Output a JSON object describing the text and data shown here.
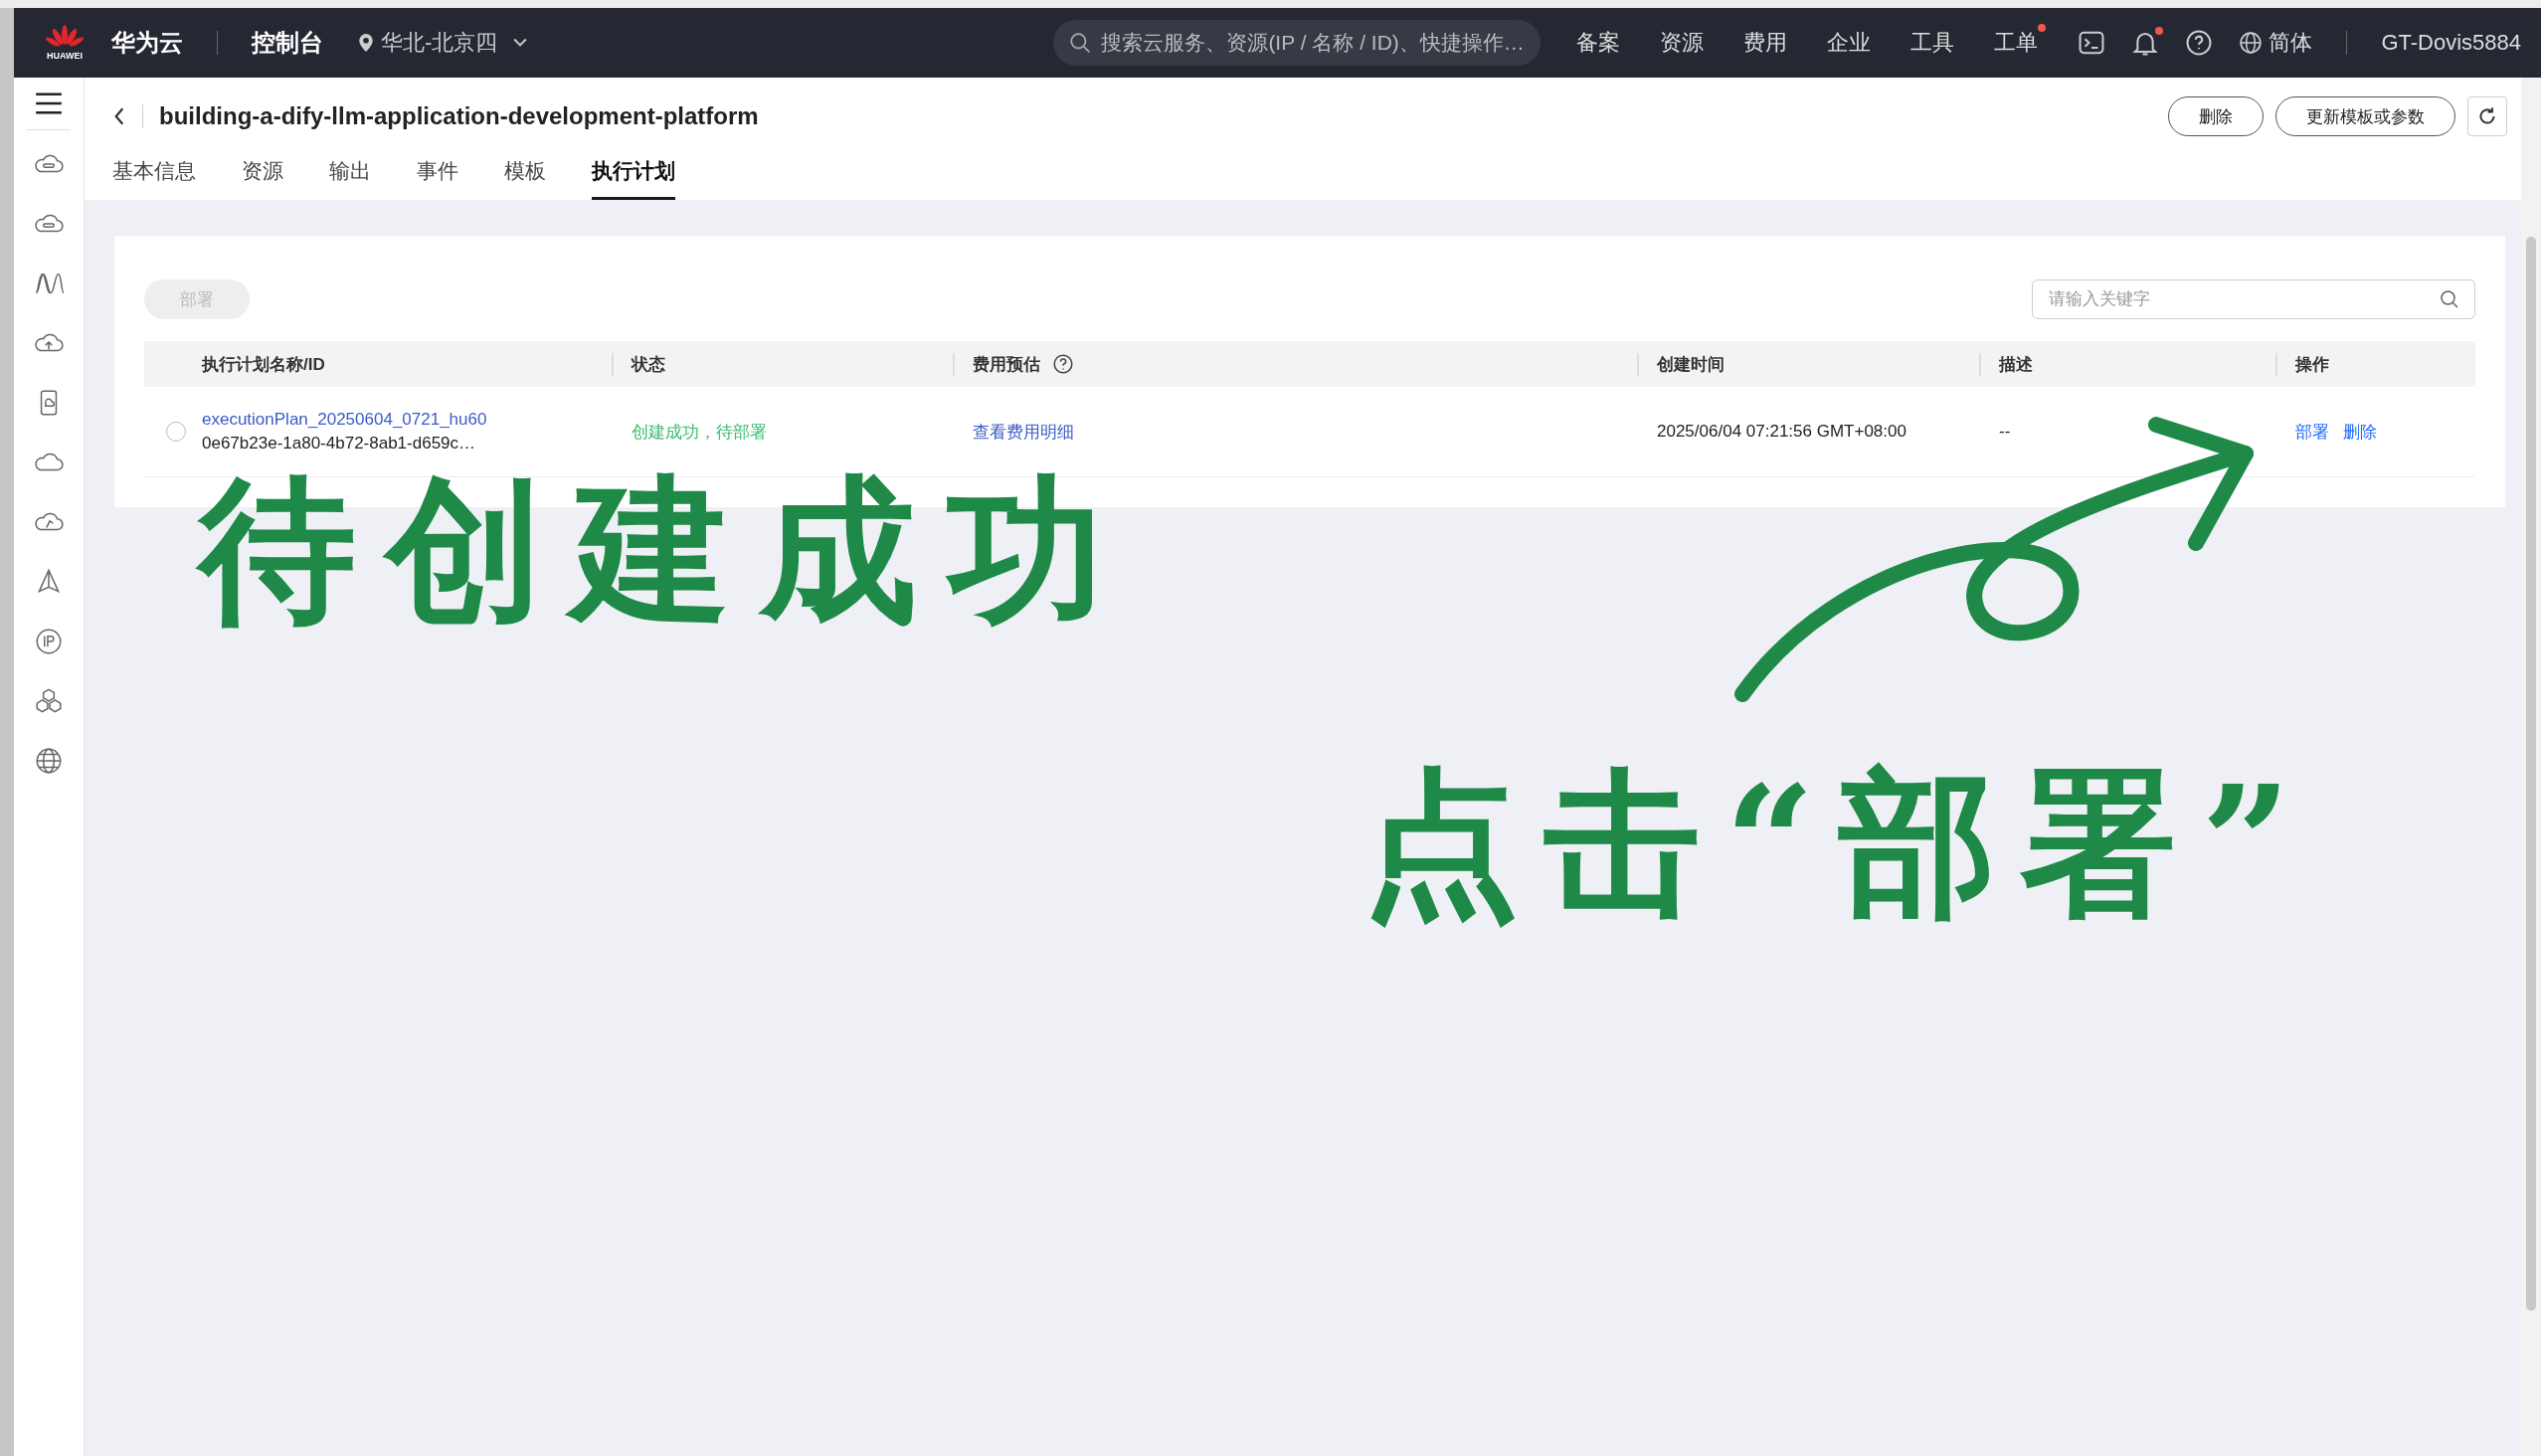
{
  "top_bar": {
    "logo_text": "HUAWEI",
    "brand": "华为云",
    "console": "控制台",
    "region": "华北-北京四",
    "search": {
      "placeholder": "搜索云服务、资源(IP / 名称 / ID)、快捷操作…"
    },
    "nav": [
      {
        "label": "备案",
        "dot": false
      },
      {
        "label": "资源",
        "dot": false
      },
      {
        "label": "费用",
        "dot": false
      },
      {
        "label": "企业",
        "dot": false
      },
      {
        "label": "工具",
        "dot": false
      },
      {
        "label": "工单",
        "dot": true
      }
    ],
    "bell_dot": true,
    "language": "简体",
    "user": "GT-Dovis5884"
  },
  "header": {
    "title": "building-a-dify-llm-application-development-platform",
    "buttons": [
      "删除",
      "更新模板或参数"
    ],
    "tabs": [
      {
        "label": "基本信息",
        "selected": false
      },
      {
        "label": "资源",
        "selected": false
      },
      {
        "label": "输出",
        "selected": false
      },
      {
        "label": "事件",
        "selected": false
      },
      {
        "label": "模板",
        "selected": false
      },
      {
        "label": "执行计划",
        "selected": true
      }
    ]
  },
  "toolbar": {
    "deploy": {
      "label": "部署",
      "disabled": true
    },
    "search": {
      "placeholder": "请输入关键字"
    }
  },
  "table": {
    "columns": [
      "执行计划名称/ID",
      "状态",
      "费用预估",
      "创建时间",
      "描述",
      "操作"
    ],
    "rows": [
      {
        "selected": false,
        "name": "executionPlan_20250604_0721_hu60",
        "id": "0e67b23e-1a80-4b72-8ab1-d659c…",
        "status": "创建成功，待部署",
        "cost": "查看费用明细",
        "created": "2025/06/04 07:21:56 GMT+08:00",
        "description": "--",
        "actions": [
          "部署",
          "删除"
        ]
      }
    ]
  },
  "annotations": [
    "待创建成功",
    "点击“部署”"
  ]
}
